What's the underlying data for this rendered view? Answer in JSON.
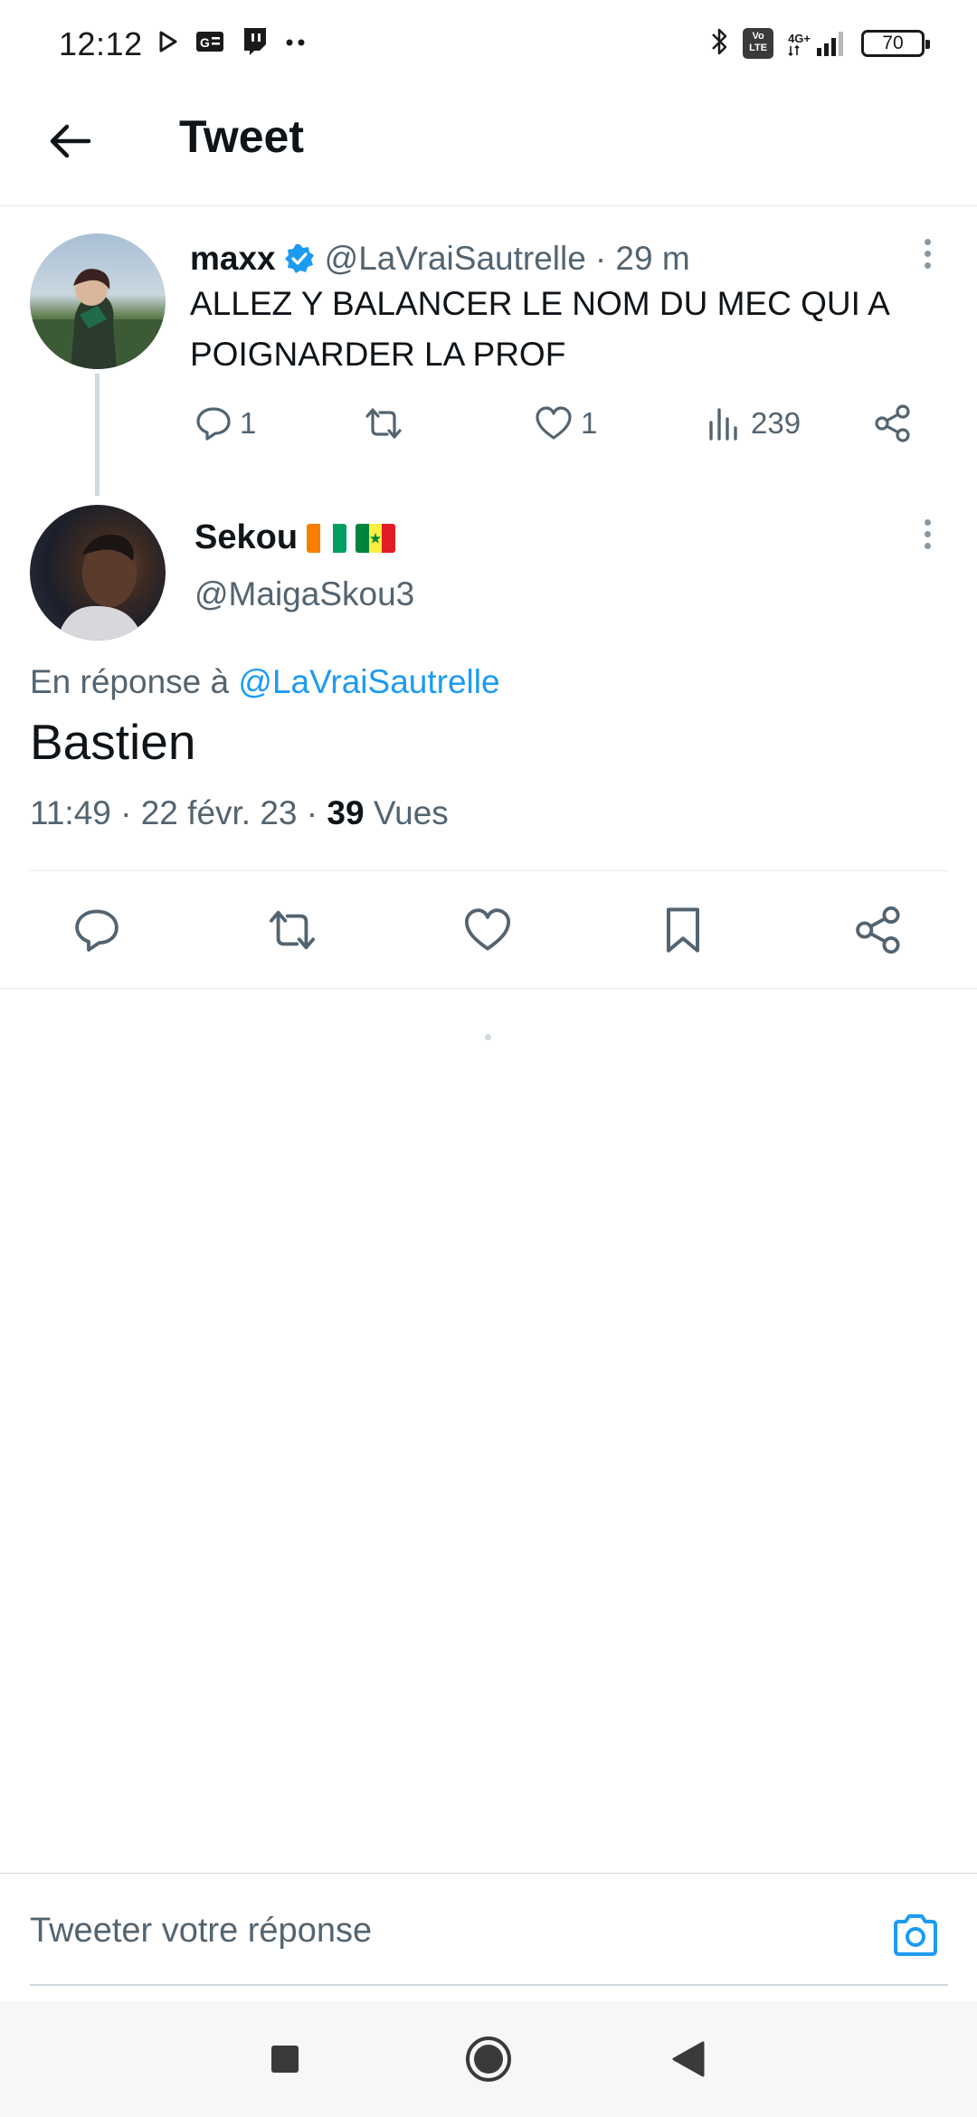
{
  "status_bar": {
    "time": "12:12",
    "left_icons": [
      "play-icon",
      "news-icon",
      "twitch-icon",
      "more-dots-icon"
    ],
    "network": "4G+",
    "volte": "Vo LTE",
    "battery": "70"
  },
  "header": {
    "title": "Tweet"
  },
  "parent_tweet": {
    "name": "maxx",
    "verified": true,
    "handle": "@LaVraiSautrelle",
    "time": "· 29 m",
    "text": "ALLEZ Y BALANCER LE NOM DU MEC QUI A POIGNARDER LA PROF",
    "replies": "1",
    "likes": "1",
    "views": "239"
  },
  "main_tweet": {
    "name": "Sekou",
    "handle": "@MaigaSkou3",
    "reply_prefix": "En réponse à",
    "reply_mention": "@LaVraiSautrelle",
    "text": "Bastien",
    "timestamp": "11:49 · 22 févr. 23 ·",
    "views_count": "39",
    "views_label": "Vues"
  },
  "composer": {
    "placeholder": "Tweeter votre réponse"
  },
  "colors": {
    "accent": "#1d9bf0",
    "text_primary": "#0f1419",
    "text_secondary": "#536471",
    "divider": "#e6e9ec"
  }
}
